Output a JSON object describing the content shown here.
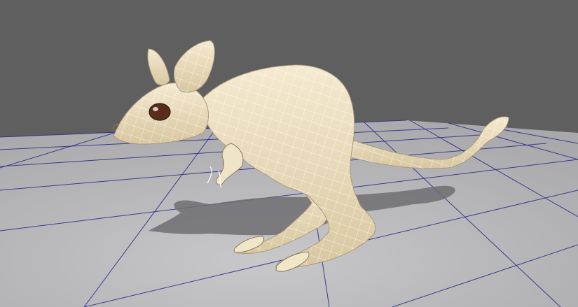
{
  "viewport": {
    "background_color": "#5f5f5f",
    "floor_color": "#b2b2b4",
    "grid_line_color": "#2b2f86",
    "model": {
      "name": "",
      "surface_color": "#efe2c2",
      "wireframe_color": "#ffffff",
      "eye_color": "#5a2d1a"
    }
  }
}
